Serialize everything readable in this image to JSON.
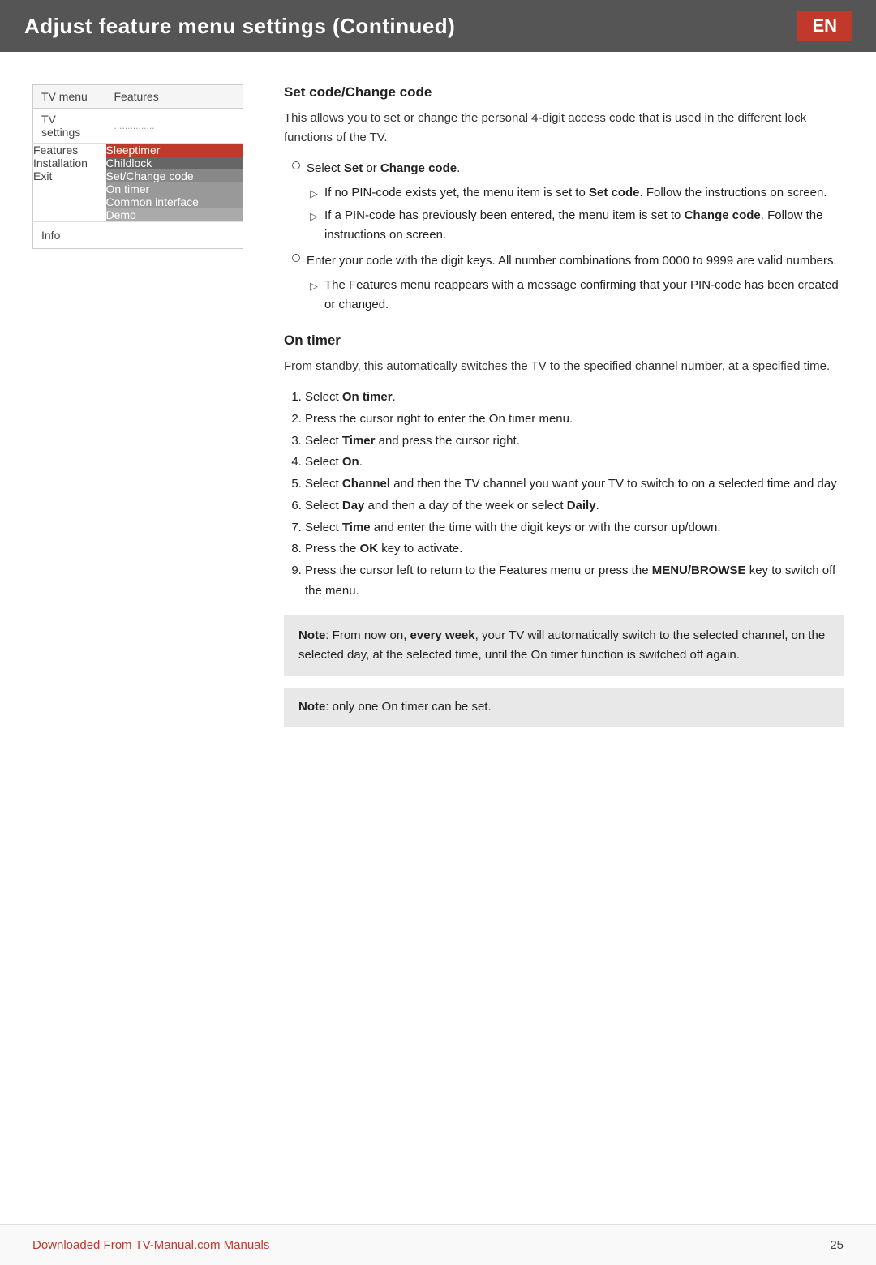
{
  "header": {
    "title": "Adjust feature menu settings  (Continued)",
    "badge": "EN"
  },
  "left_panel": {
    "menu_header": {
      "col1": "TV menu",
      "col2": "Features"
    },
    "tv_settings_row": {
      "col1": "TV settings",
      "col2": "..............."
    },
    "features_label": "Features",
    "items": [
      {
        "left": "Features",
        "right": "Sleeptimer",
        "style": "active"
      },
      {
        "left": "Installation",
        "right": "Childlock",
        "style": "dark"
      },
      {
        "left": "Exit",
        "right": "Set/Change code",
        "style": "medium"
      },
      {
        "left": "",
        "right": "On timer",
        "style": "lighter"
      },
      {
        "left": "",
        "right": "Common interface",
        "style": "lighter"
      },
      {
        "left": "",
        "right": "Demo",
        "style": "light"
      }
    ],
    "info_label": "Info"
  },
  "content": {
    "section1": {
      "title": "Set code/Change code",
      "intro": "This allows you to set or change the personal 4-digit access code that is used in the different lock functions of the TV.",
      "bullet1": {
        "text_pre": "Select ",
        "bold1": "Set",
        "text_mid": " or ",
        "bold2": "Change code",
        "text_end": ".",
        "sub1_pre": "If no PIN-code exists yet, the menu item is set to ",
        "sub1_bold": "Set code",
        "sub1_end": ". Follow the instructions on screen.",
        "sub2_pre": "If a PIN-code has previously been entered, the menu item is set to ",
        "sub2_bold": "Change code",
        "sub2_end": ". Follow the instructions on screen."
      },
      "bullet2": {
        "text": "Enter your code with the digit keys. All number combinations from 0000 to 9999 are valid numbers.",
        "sub1": "The Features menu reappears with a message confirming that your PIN-code has been created or changed."
      }
    },
    "section2": {
      "title": "On timer",
      "intro": "From standby, this automatically switches the TV to the specified channel number, at a specified time.",
      "steps": [
        {
          "num": "1.",
          "text_pre": "Select ",
          "bold": "On timer",
          "text_end": "."
        },
        {
          "num": "2.",
          "text": "Press the cursor right to enter the On timer menu."
        },
        {
          "num": "3.",
          "text_pre": "Select ",
          "bold": "Timer",
          "text_end": " and press the cursor right."
        },
        {
          "num": "4.",
          "text_pre": "Select ",
          "bold": "On",
          "text_end": "."
        },
        {
          "num": "5.",
          "text_pre": "Select ",
          "bold": "Channel",
          "text_end": " and then the TV channel you want your TV to switch to on a selected time and day"
        },
        {
          "num": "6.",
          "text_pre": "Select ",
          "bold": "Day",
          "text_end": " and then a day of the week or select ",
          "bold2": "Daily",
          "text_end2": "."
        },
        {
          "num": "7.",
          "text_pre": "Select ",
          "bold": "Time",
          "text_end": " and enter the time with the digit keys or with the cursor up/down."
        },
        {
          "num": "8.",
          "text_pre": "Press the ",
          "bold": "OK",
          "text_end": " key to activate."
        },
        {
          "num": "9.",
          "text_pre": "Press the cursor left to return to the Features menu or press the ",
          "bold": "MENU/BROWSE",
          "text_end": " key to switch off the menu."
        }
      ],
      "note1": {
        "note_bold": "Note",
        "note_pre": ": From now on, ",
        "note_bold2": "every week",
        "note_end": ", your TV will automatically switch to the selected channel, on the selected day, at the selected time, until the On timer function is switched off again."
      },
      "note2": {
        "note_bold": "Note",
        "note_end": ": only one On timer can be set."
      }
    }
  },
  "footer": {
    "link_text": "Downloaded From TV-Manual.com Manuals",
    "page_number": "25"
  }
}
